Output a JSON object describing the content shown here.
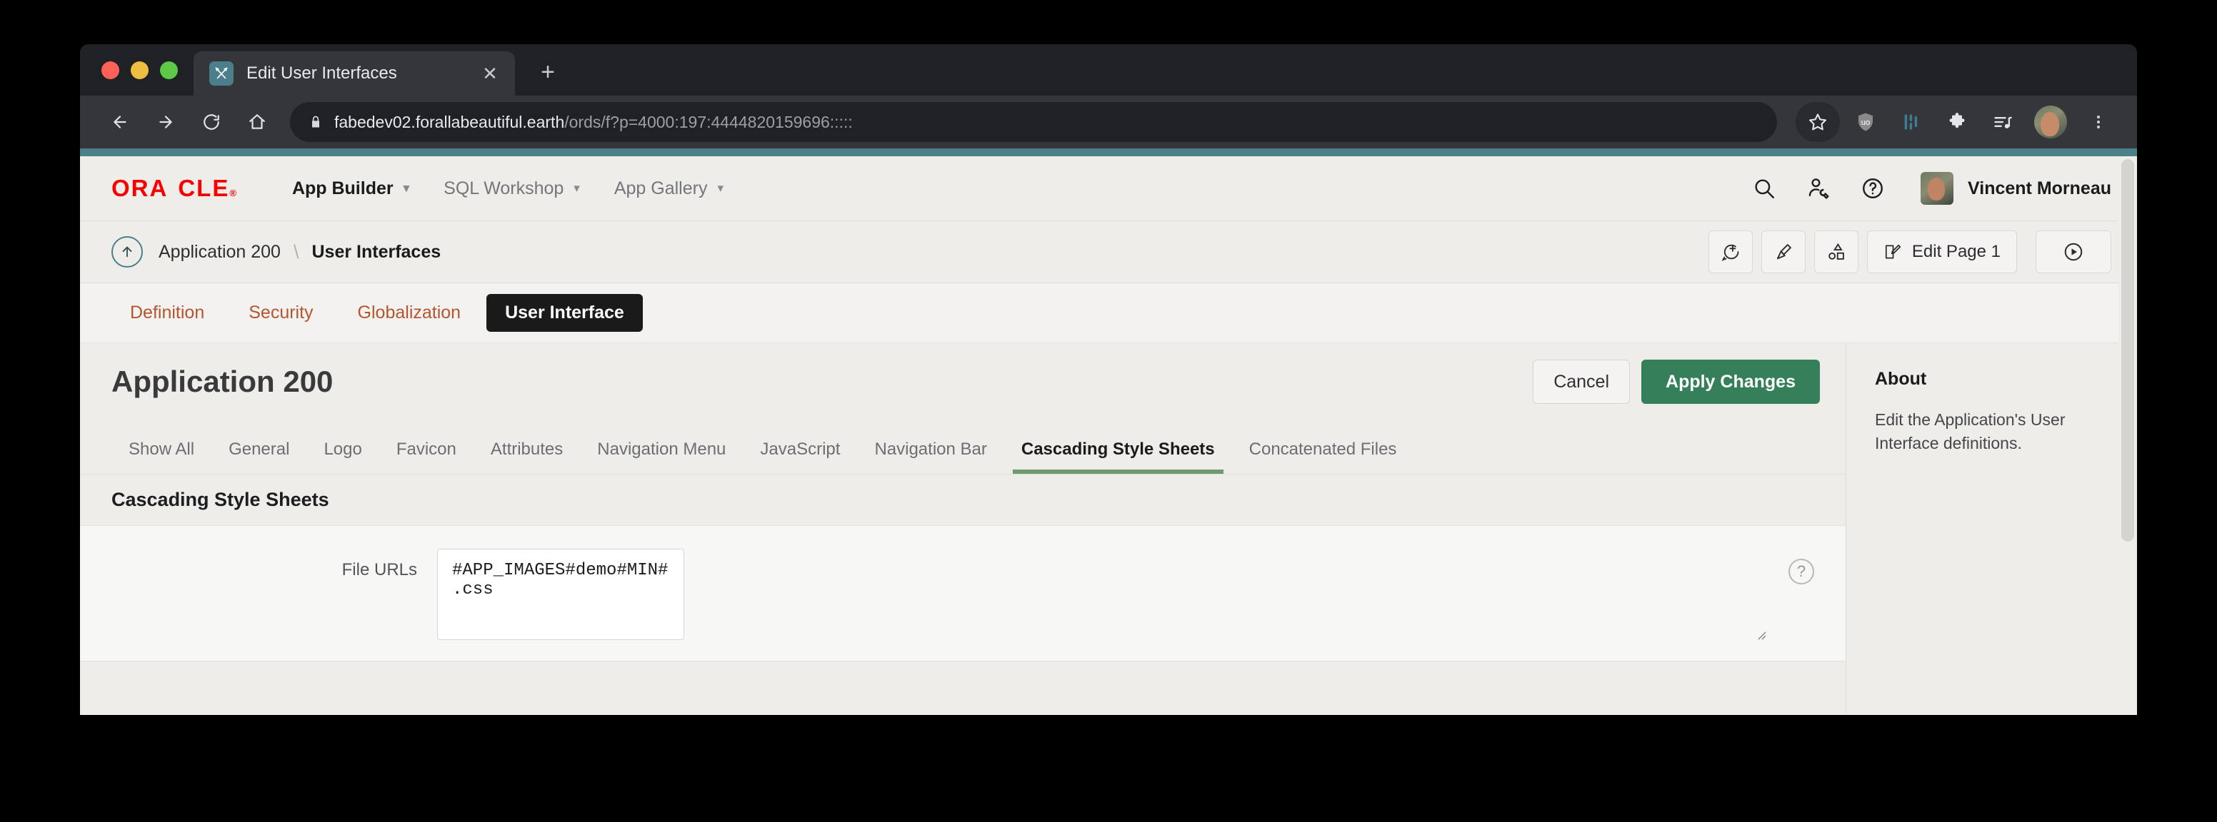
{
  "browser": {
    "tab": {
      "title": "Edit User Interfaces",
      "favicon": "pencil-ruler-icon",
      "close": "✕"
    },
    "new_tab": "+",
    "nav": {
      "back": "back-arrow-icon",
      "forward": "forward-arrow-icon",
      "reload": "reload-icon",
      "home": "home-icon"
    },
    "omnibox": {
      "lock": "lock-icon",
      "host": "fabedev02.forallabeautiful.earth",
      "path": "/ords/f?p=4000:197:4444820159696:::::"
    },
    "toolbar_icons": [
      "bookmark-star-icon",
      "ublock-shield-icon",
      "bitwarden-icon",
      "extensions-puzzle-icon",
      "media-playlist-icon",
      "profile-avatar",
      "chrome-menu-icon"
    ]
  },
  "apex": {
    "logo": "ORACLE",
    "nav": [
      {
        "label": "App Builder",
        "active": true
      },
      {
        "label": "SQL Workshop",
        "active": false
      },
      {
        "label": "App Gallery",
        "active": false
      }
    ],
    "header_icons": [
      "search-icon",
      "admin-user-icon",
      "help-icon"
    ],
    "user": "Vincent Morneau",
    "breadcrumb": {
      "up": "up-arrow-icon",
      "parent": "Application 200",
      "separator": "\\",
      "current": "User Interfaces"
    },
    "breadcrumb_actions": {
      "comment": "comment-add-icon",
      "theme_brush": "paintbrush-icon",
      "shapes": "shapes-icon",
      "edit_page": "Edit Page 1",
      "run": "run-play-icon"
    },
    "primary_tabs": [
      {
        "label": "Definition",
        "active": false
      },
      {
        "label": "Security",
        "active": false
      },
      {
        "label": "Globalization",
        "active": false
      },
      {
        "label": "User Interface",
        "active": true
      }
    ],
    "page_title": "Application 200",
    "buttons": {
      "cancel": "Cancel",
      "apply": "Apply Changes"
    },
    "secondary_tabs": [
      {
        "label": "Show All",
        "active": false
      },
      {
        "label": "General",
        "active": false
      },
      {
        "label": "Logo",
        "active": false
      },
      {
        "label": "Favicon",
        "active": false
      },
      {
        "label": "Attributes",
        "active": false
      },
      {
        "label": "Navigation Menu",
        "active": false
      },
      {
        "label": "JavaScript",
        "active": false
      },
      {
        "label": "Navigation Bar",
        "active": false
      },
      {
        "label": "Cascading Style Sheets",
        "active": true
      },
      {
        "label": "Concatenated Files",
        "active": false
      }
    ],
    "section": {
      "title": "Cascading Style Sheets"
    },
    "form": {
      "file_urls_label": "File URLs",
      "file_urls_value": "#APP_IMAGES#demo#MIN#.css",
      "help": "?"
    },
    "about": {
      "title": "About",
      "text": "Edit the Application's User Interface definitions."
    }
  },
  "colors": {
    "accent_teal": "#4A8089",
    "oracle_red": "#F80000",
    "apply_green": "#35805A",
    "tab_link_orange": "#B4562E",
    "active_tab_underline": "#6E9B6E"
  }
}
